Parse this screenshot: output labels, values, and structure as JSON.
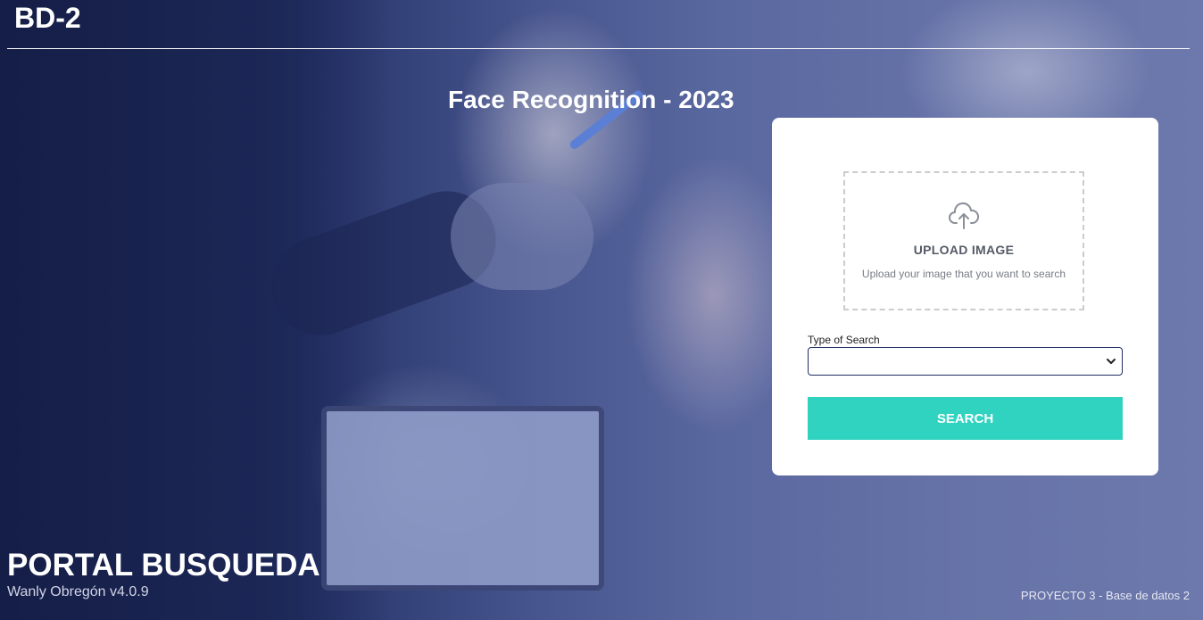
{
  "header": {
    "brand": "BD-2",
    "page_title": "Face Recognition - 2023"
  },
  "upload": {
    "icon": "cloud-upload-icon",
    "title": "UPLOAD IMAGE",
    "subtitle": "Upload your image that you want to search"
  },
  "search_form": {
    "type_label": "Type of Search",
    "type_value": "",
    "button_label": "SEARCH"
  },
  "footer": {
    "portal_title": "PORTAL BUSQUEDA",
    "author_version": "Wanly Obregón v4.0.9",
    "project": "PROYECTO 3 - Base de datos 2"
  },
  "colors": {
    "overlay": "#25336a",
    "accent": "#2fd3c0",
    "card": "#ffffff"
  }
}
